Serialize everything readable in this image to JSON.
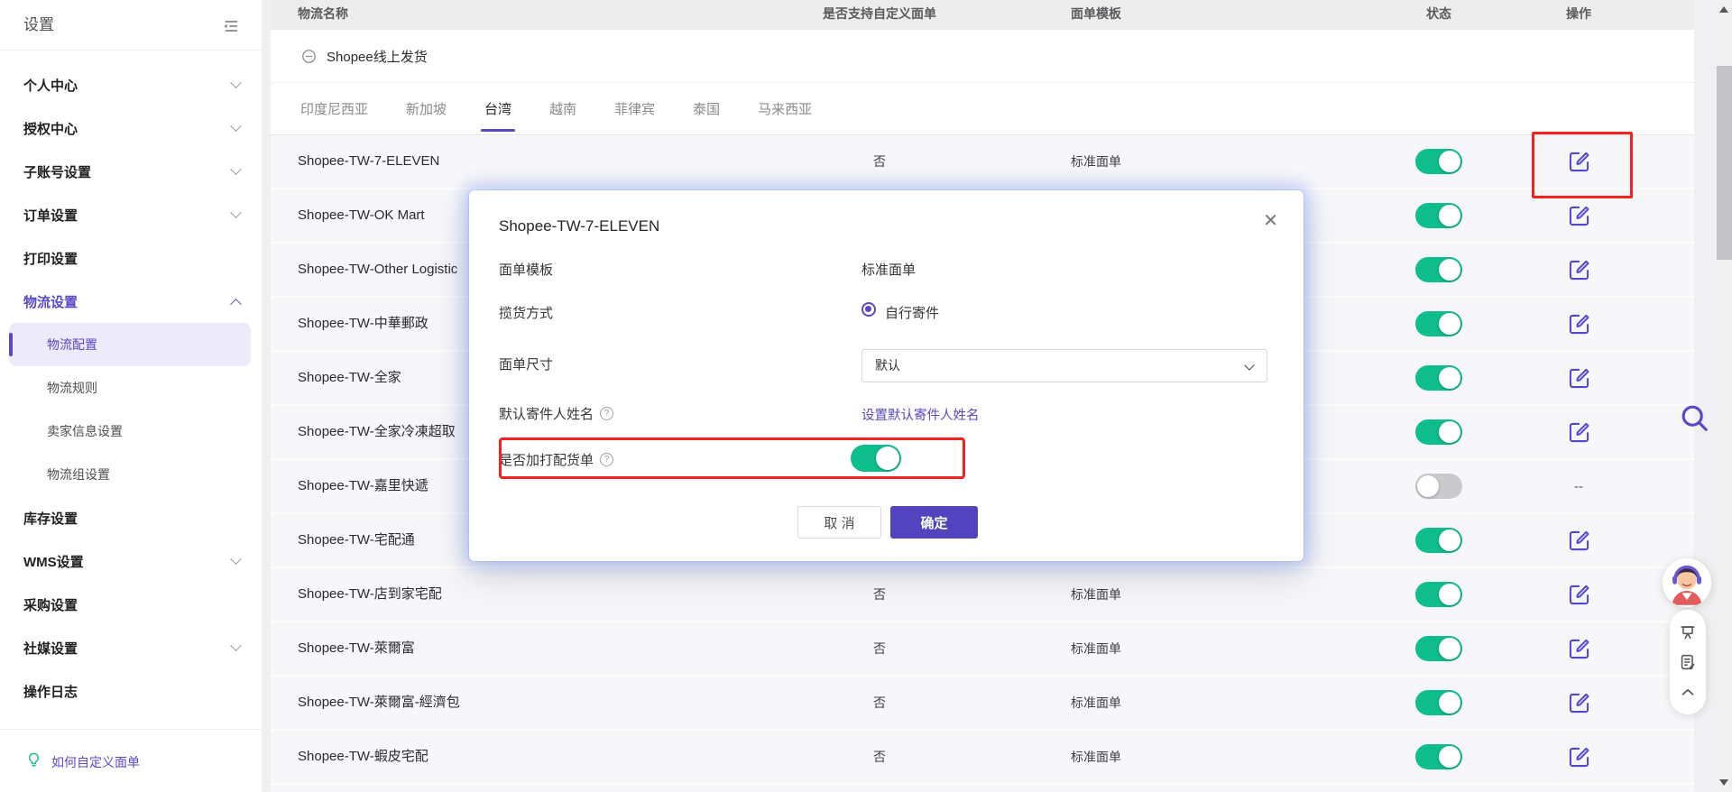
{
  "colors": {
    "brand_purple": "#5848c9",
    "toggle_green": "#0ebd8c",
    "toggle_off_gray": "#c9c9ce",
    "highlight_red": "#f52020",
    "header_gray": "#ededed"
  },
  "sidebar": {
    "title": "设置",
    "menu": [
      {
        "label": "个人中心",
        "chevron": "down"
      },
      {
        "label": "授权中心",
        "chevron": "down"
      },
      {
        "label": "子账号设置",
        "chevron": "down"
      },
      {
        "label": "订单设置",
        "chevron": "down"
      },
      {
        "label": "打印设置",
        "chevron": "none"
      },
      {
        "label": "物流设置",
        "chevron": "up",
        "active": true,
        "children": [
          {
            "label": "物流配置",
            "selected": true
          },
          {
            "label": "物流规则"
          },
          {
            "label": "卖家信息设置"
          },
          {
            "label": "物流组设置"
          }
        ]
      },
      {
        "label": "库存设置",
        "chevron": "none"
      },
      {
        "label": "WMS设置",
        "chevron": "down"
      },
      {
        "label": "采购设置",
        "chevron": "none"
      },
      {
        "label": "社媒设置",
        "chevron": "down"
      },
      {
        "label": "操作日志",
        "chevron": "none"
      }
    ],
    "footer_link": "如何自定义面单"
  },
  "table": {
    "columns": [
      "物流名称",
      "是否支持自定义面单",
      "面单模板",
      "状态",
      "操作"
    ],
    "group_label": "Shopee线上发货",
    "tabs": [
      "印度尼西亚",
      "新加坡",
      "台湾",
      "越南",
      "菲律宾",
      "泰国",
      "马来西亚"
    ],
    "active_tab": "台湾",
    "rows": [
      {
        "name": "Shopee-TW-7-ELEVEN",
        "custom": "否",
        "template": "标准面单",
        "toggle": "on",
        "action": "edit"
      },
      {
        "name": "Shopee-TW-OK Mart",
        "custom": "",
        "template": "",
        "toggle": "on",
        "action": "edit"
      },
      {
        "name": "Shopee-TW-Other Logistic",
        "custom": "",
        "template": "",
        "toggle": "on",
        "action": "edit"
      },
      {
        "name": "Shopee-TW-中華郵政",
        "custom": "",
        "template": "",
        "toggle": "on",
        "action": "edit"
      },
      {
        "name": "Shopee-TW-全家",
        "custom": "",
        "template": "",
        "toggle": "on",
        "action": "edit"
      },
      {
        "name": "Shopee-TW-全家冷凍超取",
        "custom": "",
        "template": "",
        "toggle": "on",
        "action": "edit"
      },
      {
        "name": "Shopee-TW-嘉里快遞",
        "custom": "",
        "template": "",
        "toggle": "off",
        "action": "dash",
        "action_text": "--"
      },
      {
        "name": "Shopee-TW-宅配通",
        "custom": "",
        "template": "",
        "toggle": "on",
        "action": "edit"
      },
      {
        "name": "Shopee-TW-店到家宅配",
        "custom": "否",
        "template": "标准面单",
        "toggle": "on",
        "action": "edit"
      },
      {
        "name": "Shopee-TW-萊爾富",
        "custom": "否",
        "template": "标准面单",
        "toggle": "on",
        "action": "edit"
      },
      {
        "name": "Shopee-TW-萊爾富-經濟包",
        "custom": "否",
        "template": "标准面单",
        "toggle": "on",
        "action": "edit"
      },
      {
        "name": "Shopee-TW-蝦皮宅配",
        "custom": "否",
        "template": "标准面单",
        "toggle": "on",
        "action": "edit"
      }
    ]
  },
  "modal": {
    "title": "Shopee-TW-7-ELEVEN",
    "fields": [
      {
        "label": "面单模板",
        "type": "text",
        "value": "标准面单"
      },
      {
        "label": "揽货方式",
        "type": "radio",
        "value": "自行寄件",
        "checked": true
      },
      {
        "label": "面单尺寸",
        "type": "select",
        "value": "默认"
      },
      {
        "label": "默认寄件人姓名",
        "help": true,
        "type": "link",
        "value": "设置默认寄件人姓名"
      },
      {
        "label": "是否加打配货单",
        "help": true,
        "type": "toggle",
        "value": "on",
        "highlighted": true
      }
    ],
    "cancel_label": "取 消",
    "ok_label": "确定"
  }
}
